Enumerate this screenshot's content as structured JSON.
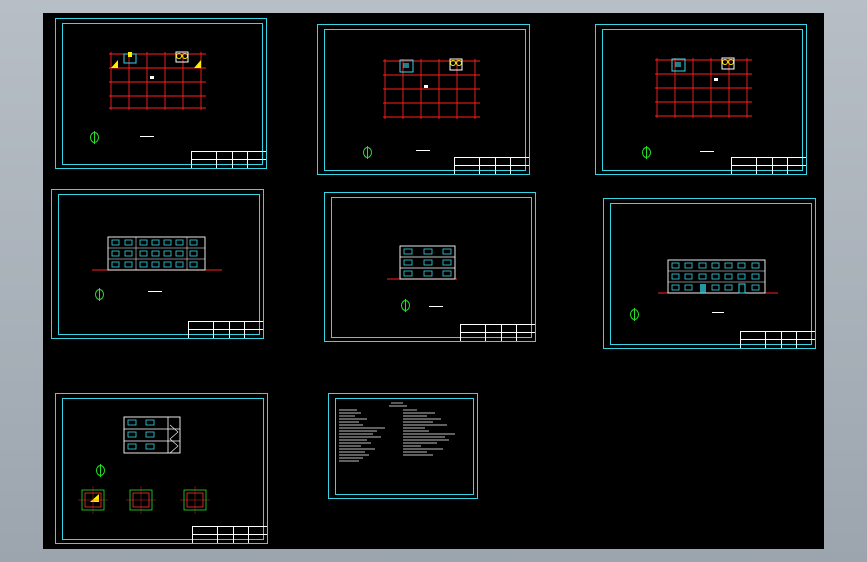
{
  "workspace": {
    "background": "#000000",
    "sheet_border_color": "#34d6e6"
  },
  "sheets": [
    {
      "name": "floor-plan-sheet-1",
      "type": "floor-plan"
    },
    {
      "name": "floor-plan-sheet-2",
      "type": "floor-plan"
    },
    {
      "name": "floor-plan-sheet-3",
      "type": "floor-plan"
    },
    {
      "name": "elevation-sheet-1",
      "type": "elevation"
    },
    {
      "name": "elevation-sheet-2",
      "type": "elevation"
    },
    {
      "name": "elevation-sheet-3",
      "type": "elevation"
    },
    {
      "name": "section-detail-sheet",
      "type": "section-and-details"
    },
    {
      "name": "design-notes-sheet",
      "type": "notes"
    }
  ],
  "colors": {
    "grid": "#ff2020",
    "window": "#34d6e6",
    "outline": "#ffffff",
    "accent_yellow": "#ffee00",
    "north_arrow": "#28e028",
    "column_detail": "#ff3030"
  }
}
